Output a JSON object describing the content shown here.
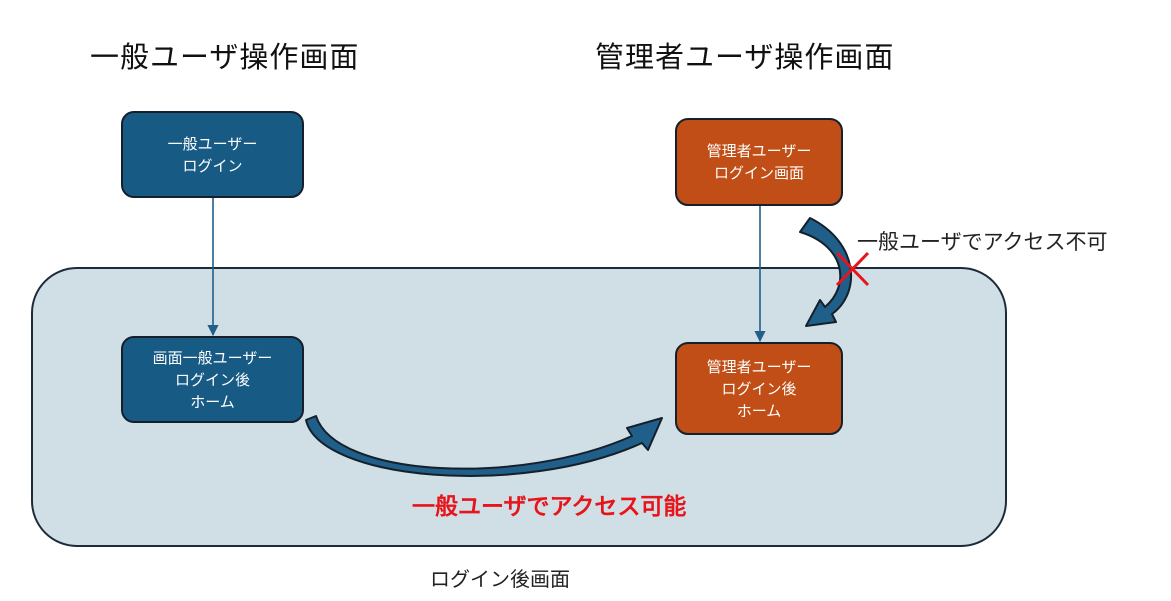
{
  "headings": {
    "general": "一般ユーザ操作画面",
    "admin": "管理者ユーザ操作画面"
  },
  "region": {
    "label": "ログイン後画面"
  },
  "nodes": {
    "general_login": [
      "一般ユーザー",
      "ログイン"
    ],
    "admin_login": [
      "管理者ユーザー",
      "ログイン画面"
    ],
    "general_home": [
      "画面一般ユーザー",
      "ログイン後",
      "ホーム"
    ],
    "admin_home": [
      "管理者ユーザー",
      "ログイン後",
      "ホーム"
    ]
  },
  "annotations": {
    "access_denied": "一般ユーザでアクセス不可",
    "access_allowed": "一般ユーザでアクセス可能"
  },
  "colors": {
    "general_node": "#175a84",
    "admin_node": "#c04e16",
    "region_fill": "#d0dee5",
    "allowed_text": "#e8141b",
    "denied_mark": "#e8141b",
    "connector": "#1f5f8a"
  }
}
